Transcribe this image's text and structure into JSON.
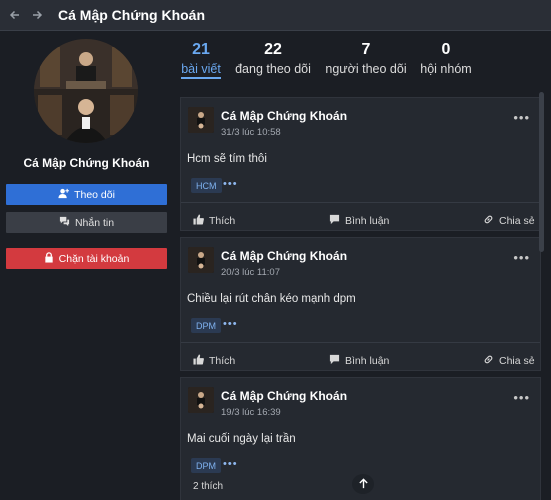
{
  "window": {
    "title": "Cá Mập Chứng Khoán"
  },
  "profile": {
    "name": "Cá Mập Chứng Khoán",
    "follow_label": "Theo dõi",
    "message_label": "Nhắn tin",
    "block_label": "Chặn tài khoản"
  },
  "stats": [
    {
      "value": "21",
      "label": "bài viết"
    },
    {
      "value": "22",
      "label": "đang theo dõi"
    },
    {
      "value": "7",
      "label": "người theo dõi"
    },
    {
      "value": "0",
      "label": "hội nhóm"
    }
  ],
  "actions": {
    "like": "Thích",
    "comment": "Bình luận",
    "share": "Chia sẻ"
  },
  "posts": [
    {
      "author": "Cá Mập Chứng Khoán",
      "time": "31/3 lúc 10:58",
      "content": "Hcm sẽ tím thôi",
      "tag": "HCM",
      "likes": ""
    },
    {
      "author": "Cá Mập Chứng Khoán",
      "time": "20/3 lúc 11:07",
      "content": "Chiều lại rút chân kéo mạnh dpm",
      "tag": "DPM",
      "likes": ""
    },
    {
      "author": "Cá Mập Chứng Khoán",
      "time": "19/3 lúc 16:39",
      "content": "Mai cuối ngày lại trần",
      "tag": "DPM",
      "likes": "2 thích"
    }
  ],
  "colors": {
    "accent": "#6aa8f0",
    "follow": "#2f6fd6",
    "block": "#d33a3f",
    "tag_bg": "#2b3a52"
  },
  "icons": {
    "back": "arrow-left-icon",
    "forward": "arrow-right-icon",
    "more": "more-dots-icon",
    "scroll_top": "arrow-up-icon"
  }
}
